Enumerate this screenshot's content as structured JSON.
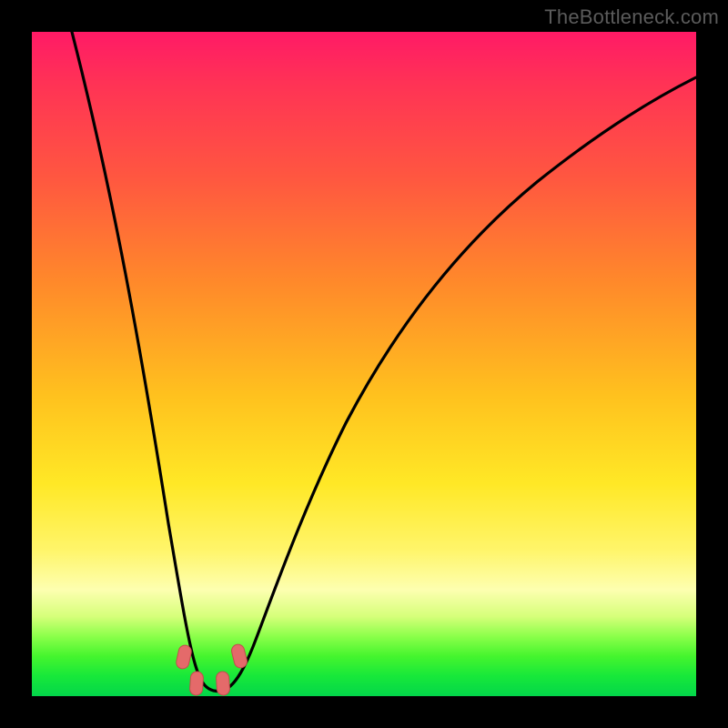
{
  "watermark": "TheBottleneck.com",
  "colors": {
    "frame": "#000000",
    "curve": "#000000",
    "marker_fill": "#e46a6a",
    "marker_stroke": "#c24d4d"
  },
  "chart_data": {
    "type": "line",
    "title": "",
    "xlabel": "",
    "ylabel": "",
    "xlim": [
      0,
      100
    ],
    "ylim": [
      0,
      100
    ],
    "grid": false,
    "legend": false,
    "note": "Bottleneck-style V-curve. Y is mismatch % (0 = ideal, bottom). Minimum plateau around x≈24–30.",
    "series": [
      {
        "name": "bottleneck-curve",
        "x": [
          6,
          10,
          14,
          18,
          21,
          24,
          26,
          28,
          30,
          34,
          40,
          48,
          58,
          70,
          84,
          100
        ],
        "y": [
          100,
          72,
          48,
          27,
          12,
          3,
          1,
          1,
          3,
          11,
          25,
          42,
          58,
          71,
          80,
          86
        ]
      }
    ],
    "markers": [
      {
        "x": 22.5,
        "y": 6,
        "label": "left-shoulder"
      },
      {
        "x": 24.5,
        "y": 2,
        "label": "valley-left"
      },
      {
        "x": 28.5,
        "y": 2,
        "label": "valley-right"
      },
      {
        "x": 31.0,
        "y": 6,
        "label": "right-shoulder"
      }
    ]
  }
}
